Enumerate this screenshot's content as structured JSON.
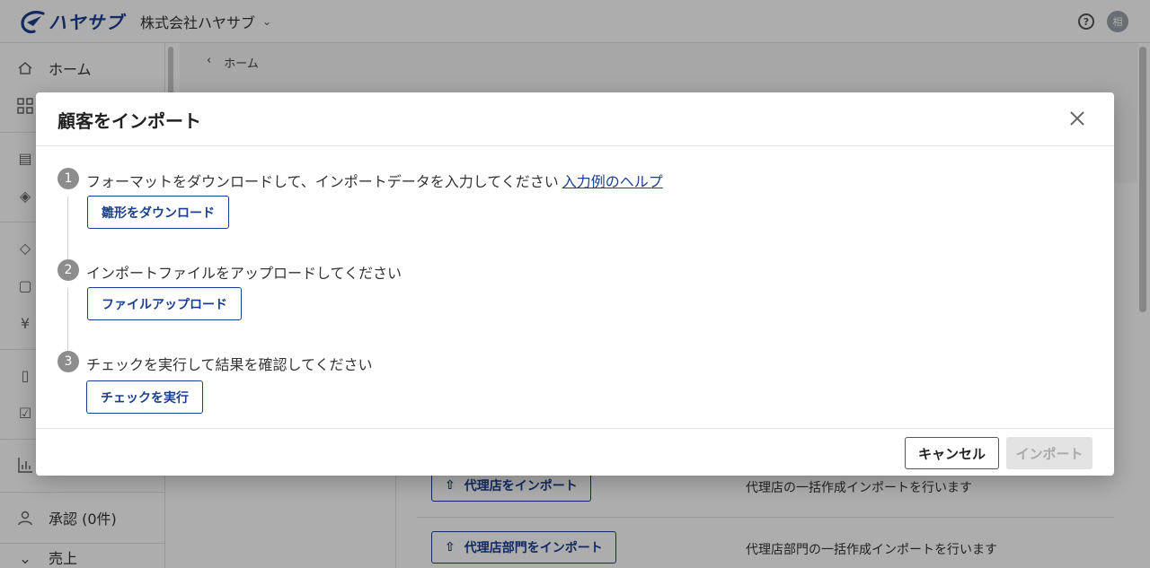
{
  "app": {
    "logo_text": "ハヤサブ",
    "company_name": "株式会社ハヤサブ",
    "avatar_initial": "相",
    "help_glyph": "?"
  },
  "sidebar": {
    "items": [
      {
        "label": "ホーム",
        "icon": "home-icon"
      },
      {
        "label": "承認 (0件)",
        "icon": "user-icon"
      },
      {
        "label": "売上",
        "icon": "chart-icon"
      }
    ]
  },
  "breadcrumb": {
    "label": "ホーム"
  },
  "background_rows": [
    {
      "button": "代理店をインポート",
      "description": "代理店の一括作成インポートを行います"
    },
    {
      "button": "代理店部門をインポート",
      "description": "代理店部門の一括作成インポートを行います"
    }
  ],
  "modal": {
    "title": "顧客をインポート",
    "steps": [
      {
        "num": "1",
        "text": "フォーマットをダウンロードして、インポートデータを入力してください",
        "link": "入力例のヘルプ",
        "button": "雛形をダウンロード"
      },
      {
        "num": "2",
        "text": "インポートファイルをアップロードしてください",
        "link": "",
        "button": "ファイルアップロード"
      },
      {
        "num": "3",
        "text": "チェックを実行して結果を確認してください",
        "link": "",
        "button": "チェックを実行"
      }
    ],
    "cancel_label": "キャンセル",
    "import_label": "インポート"
  },
  "colors": {
    "brand": "#1b3f8f",
    "step_badge": "#8d8d8d",
    "disabled_bg": "#e3e3e3"
  }
}
